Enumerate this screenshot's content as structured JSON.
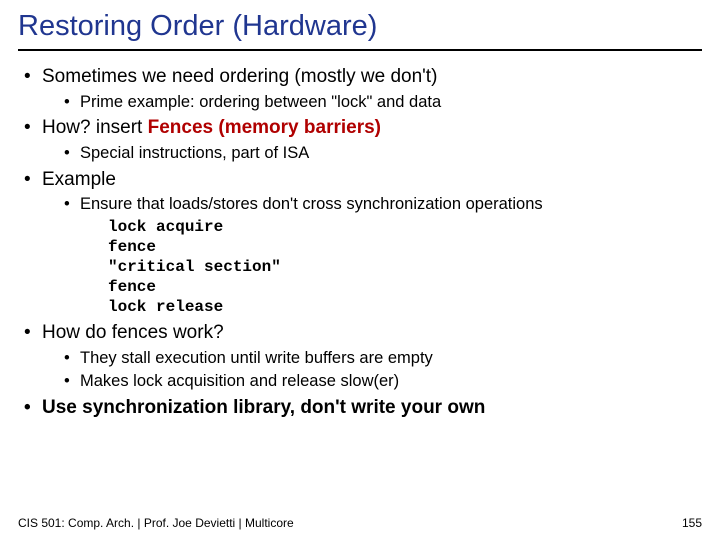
{
  "title": "Restoring Order (Hardware)",
  "bullets": {
    "b1": "Sometimes we need ordering (mostly we don't)",
    "b1_1": "Prime example: ordering between \"lock\" and data",
    "b2_pre": "How?  insert ",
    "b2_hl": "Fences (memory barriers)",
    "b2_1": "Special instructions, part of ISA",
    "b3": "Example",
    "b3_1": "Ensure that loads/stores don't cross synchronization operations",
    "code": {
      "l1": "lock acquire",
      "l2": "fence",
      "l3": "\"critical section\"",
      "l4": "fence",
      "l5": "lock release"
    },
    "b4": "How do fences work?",
    "b4_1": "They stall execution until write buffers are empty",
    "b4_2": "Makes lock acquisition and release slow(er)",
    "b5": "Use synchronization library, don't write your own"
  },
  "footer": {
    "left": "CIS 501: Comp. Arch.  |  Prof. Joe Devietti  |  Multicore",
    "right": "155"
  }
}
